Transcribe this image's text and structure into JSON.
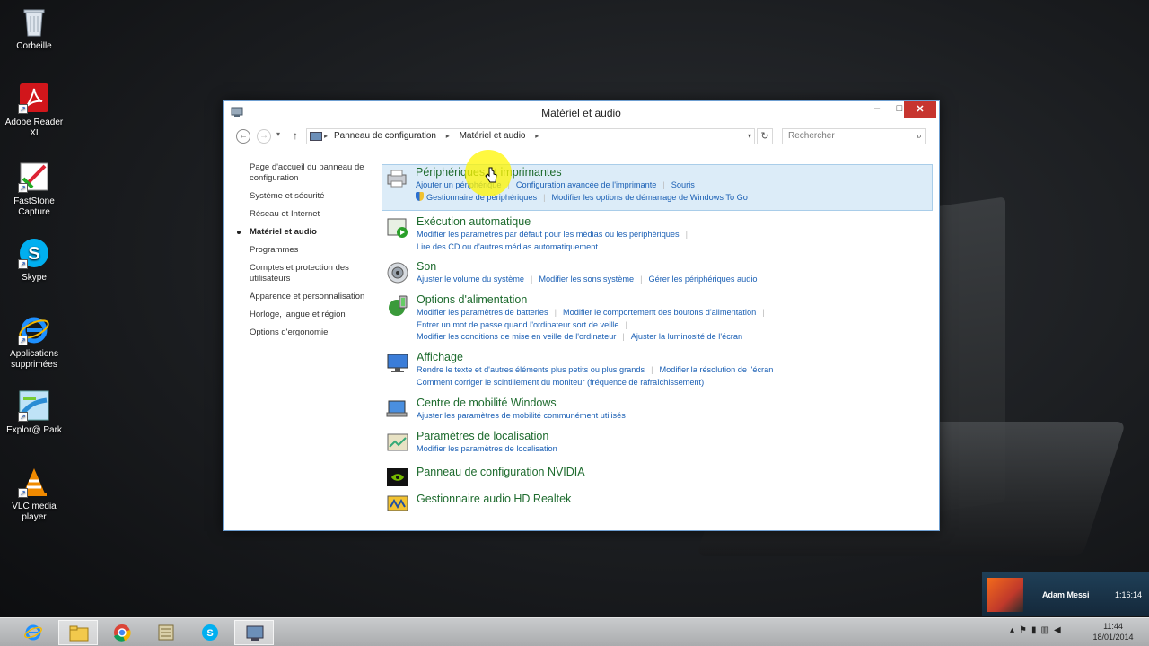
{
  "desktop": {
    "icons": [
      {
        "label": "Corbeille",
        "icon": "recycle-bin-icon"
      },
      {
        "label": "Adobe Reader XI",
        "icon": "adobe-reader-icon"
      },
      {
        "label": "FastStone Capture",
        "icon": "faststone-icon"
      },
      {
        "label": "Skype",
        "icon": "skype-icon"
      },
      {
        "label": "Applications supprimées",
        "icon": "ie-icon"
      },
      {
        "label": "Explor@ Park",
        "icon": "explorer-park-icon"
      },
      {
        "label": "VLC media player",
        "icon": "vlc-icon"
      }
    ]
  },
  "window": {
    "title": "Matériel et audio",
    "controls": {
      "minimize": "–",
      "maximize": "□",
      "close": "✕"
    },
    "address": {
      "crumbs": [
        "Panneau de configuration",
        "Matériel et audio"
      ],
      "search_placeholder": "Rechercher"
    },
    "leftnav": [
      {
        "label": "Page d'accueil du panneau de configuration",
        "current": false
      },
      {
        "label": "Système et sécurité",
        "current": false
      },
      {
        "label": "Réseau et Internet",
        "current": false
      },
      {
        "label": "Matériel et audio",
        "current": true
      },
      {
        "label": "Programmes",
        "current": false
      },
      {
        "label": "Comptes et protection des utilisateurs",
        "current": false
      },
      {
        "label": "Apparence et personnalisation",
        "current": false
      },
      {
        "label": "Horloge, langue et région",
        "current": false
      },
      {
        "label": "Options d'ergonomie",
        "current": false
      }
    ],
    "categories": [
      {
        "title": "Périphériques et imprimantes",
        "icon": "printer-icon",
        "lines": [
          [
            "Ajouter un périphérique",
            "Configuration avancée de l'imprimante",
            "Souris"
          ],
          [
            "Gestionnaire de périphériques",
            "Modifier les options de démarrage de Windows To Go"
          ]
        ]
      },
      {
        "title": "Exécution automatique",
        "icon": "autoplay-icon",
        "lines": [
          [
            "Modifier les paramètres par défaut pour les médias ou les périphériques"
          ],
          [
            "Lire des CD ou d'autres médias automatiquement"
          ]
        ]
      },
      {
        "title": "Son",
        "icon": "speaker-icon",
        "lines": [
          [
            "Ajuster le volume du système",
            "Modifier les sons système",
            "Gérer les périphériques audio"
          ]
        ]
      },
      {
        "title": "Options d'alimentation",
        "icon": "power-options-icon",
        "lines": [
          [
            "Modifier les paramètres de batteries",
            "Modifier le comportement des boutons d'alimentation"
          ],
          [
            "Entrer un mot de passe quand l'ordinateur sort de veille"
          ],
          [
            "Modifier les conditions de mise en veille de l'ordinateur",
            "Ajuster la luminosité de l'écran"
          ]
        ]
      },
      {
        "title": "Affichage",
        "icon": "display-icon",
        "lines": [
          [
            "Rendre le texte et d'autres éléments plus petits ou plus grands",
            "Modifier la résolution de l'écran"
          ],
          [
            "Comment corriger le scintillement du moniteur (fréquence de rafraîchissement)"
          ]
        ]
      },
      {
        "title": "Centre de mobilité Windows",
        "icon": "mobility-center-icon",
        "lines": [
          [
            "Ajuster les paramètres de mobilité communément utilisés"
          ]
        ]
      },
      {
        "title": "Paramètres de localisation",
        "icon": "location-icon",
        "lines": [
          [
            "Modifier les paramètres de localisation"
          ]
        ]
      },
      {
        "title": "Panneau de configuration NVIDIA",
        "icon": "nvidia-icon",
        "lines": []
      },
      {
        "title": "Gestionnaire audio HD Realtek",
        "icon": "realtek-icon",
        "lines": []
      }
    ]
  },
  "toast": {
    "name": "Adam Messi",
    "time": "1:16:14"
  },
  "taskbar": {
    "apps": [
      "ie-icon",
      "file-explorer-icon",
      "chrome-icon",
      "archive-icon",
      "skype-icon",
      "control-panel-icon"
    ],
    "clock_time": "11:44",
    "clock_date": "18/01/2014"
  },
  "colors": {
    "category_title": "#1e6b2e",
    "link": "#1a5fb4",
    "highlight": "#dcecf8",
    "close_button": "#c7352f"
  }
}
